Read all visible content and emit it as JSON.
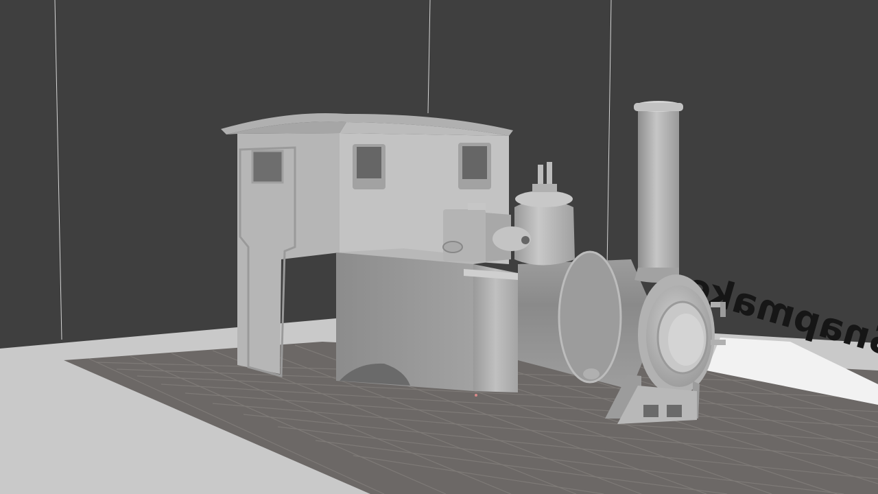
{
  "viewport": {
    "bed_label": "Snapmaker"
  },
  "colors": {
    "background": "#3f3f3f",
    "bed_frame": "#c9c9c9",
    "bed_plate": "#6c6866",
    "bed_grid": "#7e7a77",
    "model_light": "#c4c4c4",
    "model_mid": "#a8a8a8",
    "model_dark": "#7a7a7a",
    "guide_line": "#d8d8d8"
  }
}
